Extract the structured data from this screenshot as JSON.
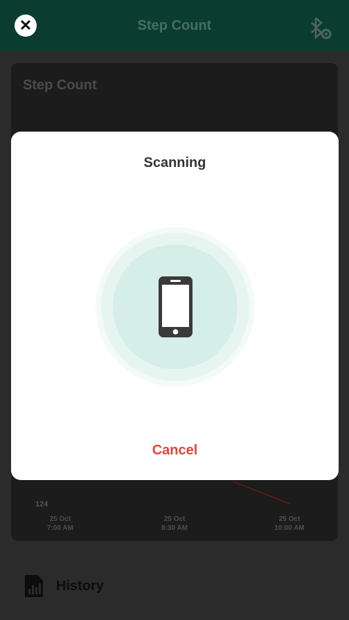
{
  "header": {
    "title": "Step Count",
    "close_icon": "close-icon",
    "settings_icon": "bluetooth-settings-icon"
  },
  "card": {
    "title": "Step Count",
    "y_tick": "124",
    "x_ticks": [
      {
        "line1": "25 Oct",
        "line2": "7:00 AM"
      },
      {
        "line1": "25 Oct",
        "line2": "8:30 AM"
      },
      {
        "line1": "25 Oct",
        "line2": "10:00 AM"
      }
    ]
  },
  "history": {
    "label": "History",
    "icon": "bar-chart-file-icon"
  },
  "modal": {
    "title": "Scanning",
    "icon": "smartphone-icon",
    "cancel_label": "Cancel"
  },
  "colors": {
    "header_bg": "#0a3d2e",
    "accent_cancel": "#e0473a",
    "scan_ring": "#d5eee7"
  }
}
